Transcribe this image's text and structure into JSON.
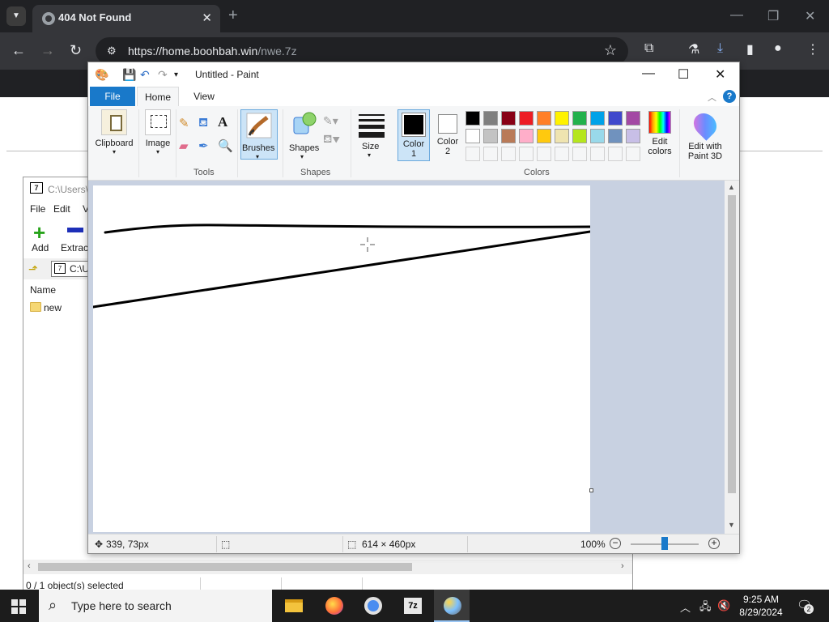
{
  "browser": {
    "tab_title": "404 Not Found",
    "url_host": "https://home.boohbah.win",
    "url_path": "/nwe.7z"
  },
  "zip": {
    "title": "C:\\Users\\",
    "menu": [
      "File",
      "Edit",
      "V"
    ],
    "add_label": "Add",
    "extract_label": "Extract",
    "path": "C:\\U",
    "column_name": "Name",
    "items": [
      "new"
    ],
    "status": "0 / 1 object(s) selected"
  },
  "paint": {
    "title": "Untitled - Paint",
    "tabs": {
      "file": "File",
      "home": "Home",
      "view": "View"
    },
    "ribbon": {
      "clipboard": "Clipboard",
      "image": "Image",
      "tools": "Tools",
      "brushes": "Brushes",
      "shapes": "Shapes",
      "shapes_group": "Shapes",
      "size": "Size",
      "color1": "Color\n1",
      "color2": "Color\n2",
      "colors_group": "Colors",
      "edit_colors": "Edit\ncolors",
      "edit_paint3d": "Edit with\nPaint 3D"
    },
    "palette_row1": [
      "#000000",
      "#7f7f7f",
      "#880015",
      "#ed1c24",
      "#ff7f27",
      "#fff200",
      "#22b14c",
      "#00a2e8",
      "#3f48cc",
      "#a349a4"
    ],
    "palette_row2": [
      "#ffffff",
      "#c3c3c3",
      "#b97a57",
      "#ffaec9",
      "#ffc90e",
      "#efe4b0",
      "#b5e61d",
      "#99d9ea",
      "#7092be",
      "#c8bfe7"
    ],
    "status": {
      "cursor_pos": "339, 73px",
      "canvas_size": "614 × 460px",
      "zoom": "100%"
    }
  },
  "taskbar": {
    "search_placeholder": "Type here to search",
    "time": "9:25 AM",
    "date": "8/29/2024",
    "notifications": "2"
  }
}
